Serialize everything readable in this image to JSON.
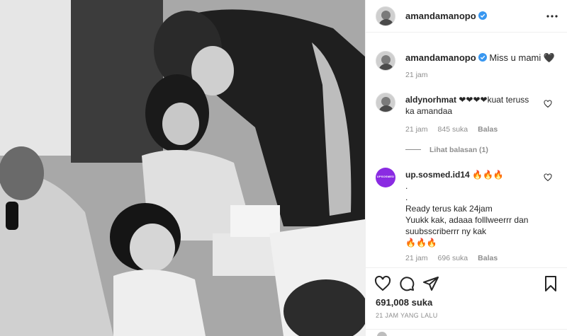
{
  "post": {
    "username": "amandamanopo",
    "caption_text": "Miss u mami 🖤",
    "caption_time": "21 jam",
    "likes": "691,008 suka",
    "posted_ago": "21 JAM YANG LALU"
  },
  "comments": [
    {
      "username": "aldynorhmat",
      "text": " ❤❤❤❤kuat teruss ka amandaa",
      "time": "21 jam",
      "likes": "845 suka",
      "reply": "Balas"
    },
    {
      "username": "up.sosmed.id14",
      "avatar_text": "UPSOSMED",
      "text_lines": [
        "🔥🔥🔥",
        ".",
        ".",
        "Ready terus kak 24jam",
        "Yuukk kak, adaaa folllweerrr dan",
        "suubsscriberrr ny kak",
        "🔥🔥🔥"
      ],
      "time": "21 jam",
      "likes": "696 suka",
      "reply": "Balas"
    }
  ],
  "view_replies": "Lihat balasan (1)",
  "icons": {
    "verified": "verified-badge-icon",
    "more": "more-options-icon",
    "like": "heart-icon",
    "comment": "comment-icon",
    "share": "share-icon",
    "save": "bookmark-icon"
  },
  "colors": {
    "verified": "#3897f0",
    "spam_avatar": "#8a2be2",
    "secondary_text": "#8e8e8e"
  }
}
